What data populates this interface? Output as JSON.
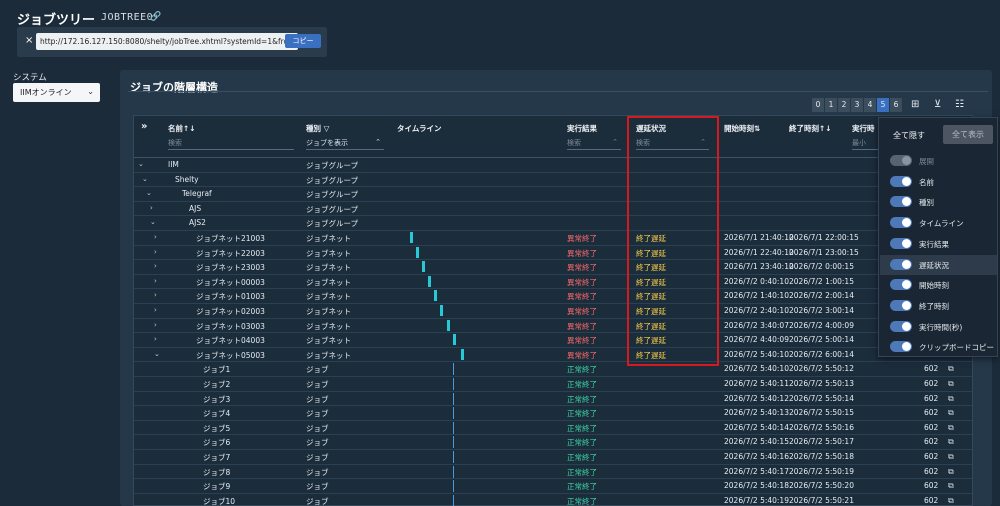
{
  "page": {
    "title": "ジョブツリー",
    "subtitle": "JOBTREE0",
    "link_icon": "link-icon"
  },
  "url_bar": {
    "value": "http://172.16.127.150:8080/shelty/jobTree.xhtml?systemId=1&frc",
    "copy_label": "コピー",
    "close_icon": "×"
  },
  "system": {
    "label": "システム",
    "selected": "IIMオンライン"
  },
  "panel": {
    "title": "ジョブの階層構造",
    "levels": [
      "0",
      "1",
      "2",
      "3",
      "4",
      "5",
      "6"
    ],
    "active_level": "5"
  },
  "table": {
    "columns": {
      "expand": "»",
      "name": "名前",
      "name_sort": "↑↓",
      "kind": "種別",
      "kind_filter_icon": "▽",
      "timeline": "タイムライン",
      "result": "実行結果",
      "delay": "遅延状況",
      "start": "開始時刻",
      "start_sort": "⇅",
      "end": "終了時刻",
      "end_sort": "↑↓",
      "elapsed": "実行時"
    },
    "filters": {
      "name": "検索",
      "kind": "ジョブを表示",
      "result": "検索",
      "delay": "検索",
      "elapsed": "最小"
    },
    "rows": [
      {
        "name": "IIM",
        "kind": "ジョブグループ",
        "result": "",
        "delay": "",
        "start": "",
        "end": "",
        "elapsed": ""
      },
      {
        "name": "Shelty",
        "kind": "ジョブグループ",
        "result": "",
        "delay": "",
        "start": "",
        "end": "",
        "elapsed": ""
      },
      {
        "name": "Telegraf",
        "kind": "ジョブグループ",
        "result": "",
        "delay": "",
        "start": "",
        "end": "",
        "elapsed": ""
      },
      {
        "name": "AJS",
        "kind": "ジョブグループ",
        "result": "",
        "delay": "",
        "start": "",
        "end": "",
        "elapsed": ""
      },
      {
        "name": "AJS2",
        "kind": "ジョブグループ",
        "result": "",
        "delay": "",
        "start": "",
        "end": "",
        "elapsed": ""
      },
      {
        "name": "ジョブネット21003",
        "kind": "ジョブネット",
        "result": "異常終了",
        "delay": "終了遅延",
        "start": "2026/7/1 21:40:10",
        "end": "2026/7/1 22:00:15",
        "elapsed": ""
      },
      {
        "name": "ジョブネット22003",
        "kind": "ジョブネット",
        "result": "異常終了",
        "delay": "終了遅延",
        "start": "2026/7/1 22:40:10",
        "end": "2026/7/1 23:00:15",
        "elapsed": ""
      },
      {
        "name": "ジョブネット23003",
        "kind": "ジョブネット",
        "result": "異常終了",
        "delay": "終了遅延",
        "start": "2026/7/1 23:40:10",
        "end": "2026/7/2 0:00:15",
        "elapsed": ""
      },
      {
        "name": "ジョブネット00003",
        "kind": "ジョブネット",
        "result": "異常終了",
        "delay": "終了遅延",
        "start": "2026/7/2 0:40:10",
        "end": "2026/7/2 1:00:15",
        "elapsed": ""
      },
      {
        "name": "ジョブネット01003",
        "kind": "ジョブネット",
        "result": "異常終了",
        "delay": "終了遅延",
        "start": "2026/7/2 1:40:10",
        "end": "2026/7/2 2:00:14",
        "elapsed": ""
      },
      {
        "name": "ジョブネット02003",
        "kind": "ジョブネット",
        "result": "異常終了",
        "delay": "終了遅延",
        "start": "2026/7/2 2:40:10",
        "end": "2026/7/2 3:00:14",
        "elapsed": ""
      },
      {
        "name": "ジョブネット03003",
        "kind": "ジョブネット",
        "result": "異常終了",
        "delay": "終了遅延",
        "start": "2026/7/2 3:40:07",
        "end": "2026/7/2 4:00:09",
        "elapsed": ""
      },
      {
        "name": "ジョブネット04003",
        "kind": "ジョブネット",
        "result": "異常終了",
        "delay": "終了遅延",
        "start": "2026/7/2 4:40:09",
        "end": "2026/7/2 5:00:14",
        "elapsed": ""
      },
      {
        "name": "ジョブネット05003",
        "kind": "ジョブネット",
        "result": "異常終了",
        "delay": "終了遅延",
        "start": "2026/7/2 5:40:10",
        "end": "2026/7/2 6:00:14",
        "elapsed": ""
      },
      {
        "name": "ジョブ1",
        "kind": "ジョブ",
        "result": "正常終了",
        "delay": "",
        "start": "2026/7/2 5:40:10",
        "end": "2026/7/2 5:50:12",
        "elapsed": "602"
      },
      {
        "name": "ジョブ2",
        "kind": "ジョブ",
        "result": "正常終了",
        "delay": "",
        "start": "2026/7/2 5:40:11",
        "end": "2026/7/2 5:50:13",
        "elapsed": "602"
      },
      {
        "name": "ジョブ3",
        "kind": "ジョブ",
        "result": "正常終了",
        "delay": "",
        "start": "2026/7/2 5:40:12",
        "end": "2026/7/2 5:50:14",
        "elapsed": "602"
      },
      {
        "name": "ジョブ4",
        "kind": "ジョブ",
        "result": "正常終了",
        "delay": "",
        "start": "2026/7/2 5:40:13",
        "end": "2026/7/2 5:50:15",
        "elapsed": "602"
      },
      {
        "name": "ジョブ5",
        "kind": "ジョブ",
        "result": "正常終了",
        "delay": "",
        "start": "2026/7/2 5:40:14",
        "end": "2026/7/2 5:50:16",
        "elapsed": "602"
      },
      {
        "name": "ジョブ6",
        "kind": "ジョブ",
        "result": "正常終了",
        "delay": "",
        "start": "2026/7/2 5:40:15",
        "end": "2026/7/2 5:50:17",
        "elapsed": "602"
      },
      {
        "name": "ジョブ7",
        "kind": "ジョブ",
        "result": "正常終了",
        "delay": "",
        "start": "2026/7/2 5:40:16",
        "end": "2026/7/2 5:50:18",
        "elapsed": "602"
      },
      {
        "name": "ジョブ8",
        "kind": "ジョブ",
        "result": "正常終了",
        "delay": "",
        "start": "2026/7/2 5:40:17",
        "end": "2026/7/2 5:50:19",
        "elapsed": "602"
      },
      {
        "name": "ジョブ9",
        "kind": "ジョブ",
        "result": "正常終了",
        "delay": "",
        "start": "2026/7/2 5:40:18",
        "end": "2026/7/2 5:50:20",
        "elapsed": "602"
      },
      {
        "name": "ジョブ10",
        "kind": "ジョブ",
        "result": "正常終了",
        "delay": "",
        "start": "2026/7/2 5:40:19",
        "end": "2026/7/2 5:50:21",
        "elapsed": "602"
      }
    ]
  },
  "column_menu": {
    "hide_all": "全て隠す",
    "show_all": "全て表示",
    "items": [
      {
        "label": "展開",
        "on": false,
        "disabled": true
      },
      {
        "label": "名前",
        "on": true,
        "disabled": false
      },
      {
        "label": "種別",
        "on": true,
        "disabled": false
      },
      {
        "label": "タイムライン",
        "on": true,
        "disabled": false
      },
      {
        "label": "実行結果",
        "on": true,
        "disabled": false
      },
      {
        "label": "遅延状況",
        "on": true,
        "disabled": false
      },
      {
        "label": "開始時刻",
        "on": true,
        "disabled": false
      },
      {
        "label": "終了時刻",
        "on": true,
        "disabled": false
      },
      {
        "label": "実行時間(秒)",
        "on": true,
        "disabled": false
      },
      {
        "label": "クリップボードコピー",
        "on": true,
        "disabled": false
      }
    ]
  },
  "colors": {
    "accent": "#3a70c2",
    "error": "#ff6b6b",
    "ok": "#3fd6a6",
    "delay": "#ffd24a",
    "highlight": "#d6191e"
  }
}
